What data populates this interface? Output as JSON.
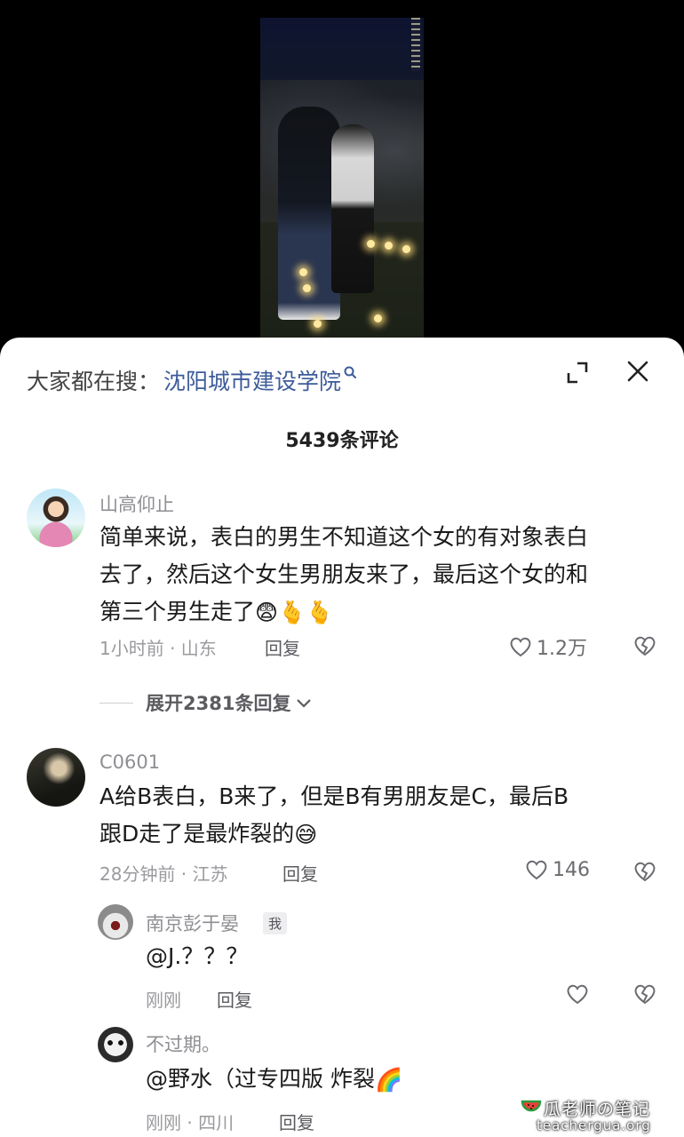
{
  "search": {
    "prefix": "大家都在搜：",
    "term": "沈阳城市建设学院"
  },
  "comments_title": "5439条评论",
  "comments": [
    {
      "username": "山高仰止",
      "text_line1": "简单来说，表白的男生不知道这个女的有对象表白",
      "text_line2": "去了，然后这个女生男朋友来了，最后这个女的和",
      "text_line3": "第三个男生走了",
      "emoji": [
        "😨",
        "🫰",
        "🫰"
      ],
      "time_location": "1小时前 · 山东",
      "reply_label": "回复",
      "likes": "1.2万",
      "expand_label": "展开2381条回复"
    },
    {
      "username": "C0601",
      "text_line1": "A给B表白，B来了，但是B有男朋友是C，最后B",
      "text_line2": "跟D走了是最炸裂的",
      "emoji": [
        "😅"
      ],
      "time_location": "28分钟前 · 江苏",
      "reply_label": "回复",
      "likes": "146"
    }
  ],
  "replies": [
    {
      "username": "南京彭于晏",
      "badge": "我",
      "text": "@J.？？？",
      "time_location": "刚刚",
      "reply_label": "回复"
    },
    {
      "username": "不过期。",
      "text": "@野水（过专四版 炸裂",
      "emoji": "🌈",
      "time_location": "刚刚 · 四川",
      "reply_label": "回复"
    }
  ],
  "watermark": {
    "title": "瓜老师の笔记",
    "url": "teachergua.org"
  },
  "colors": {
    "search_term": "#3d5b9a",
    "meta_gray": "#9a9a9f",
    "text_dark": "#1a1a1a"
  }
}
